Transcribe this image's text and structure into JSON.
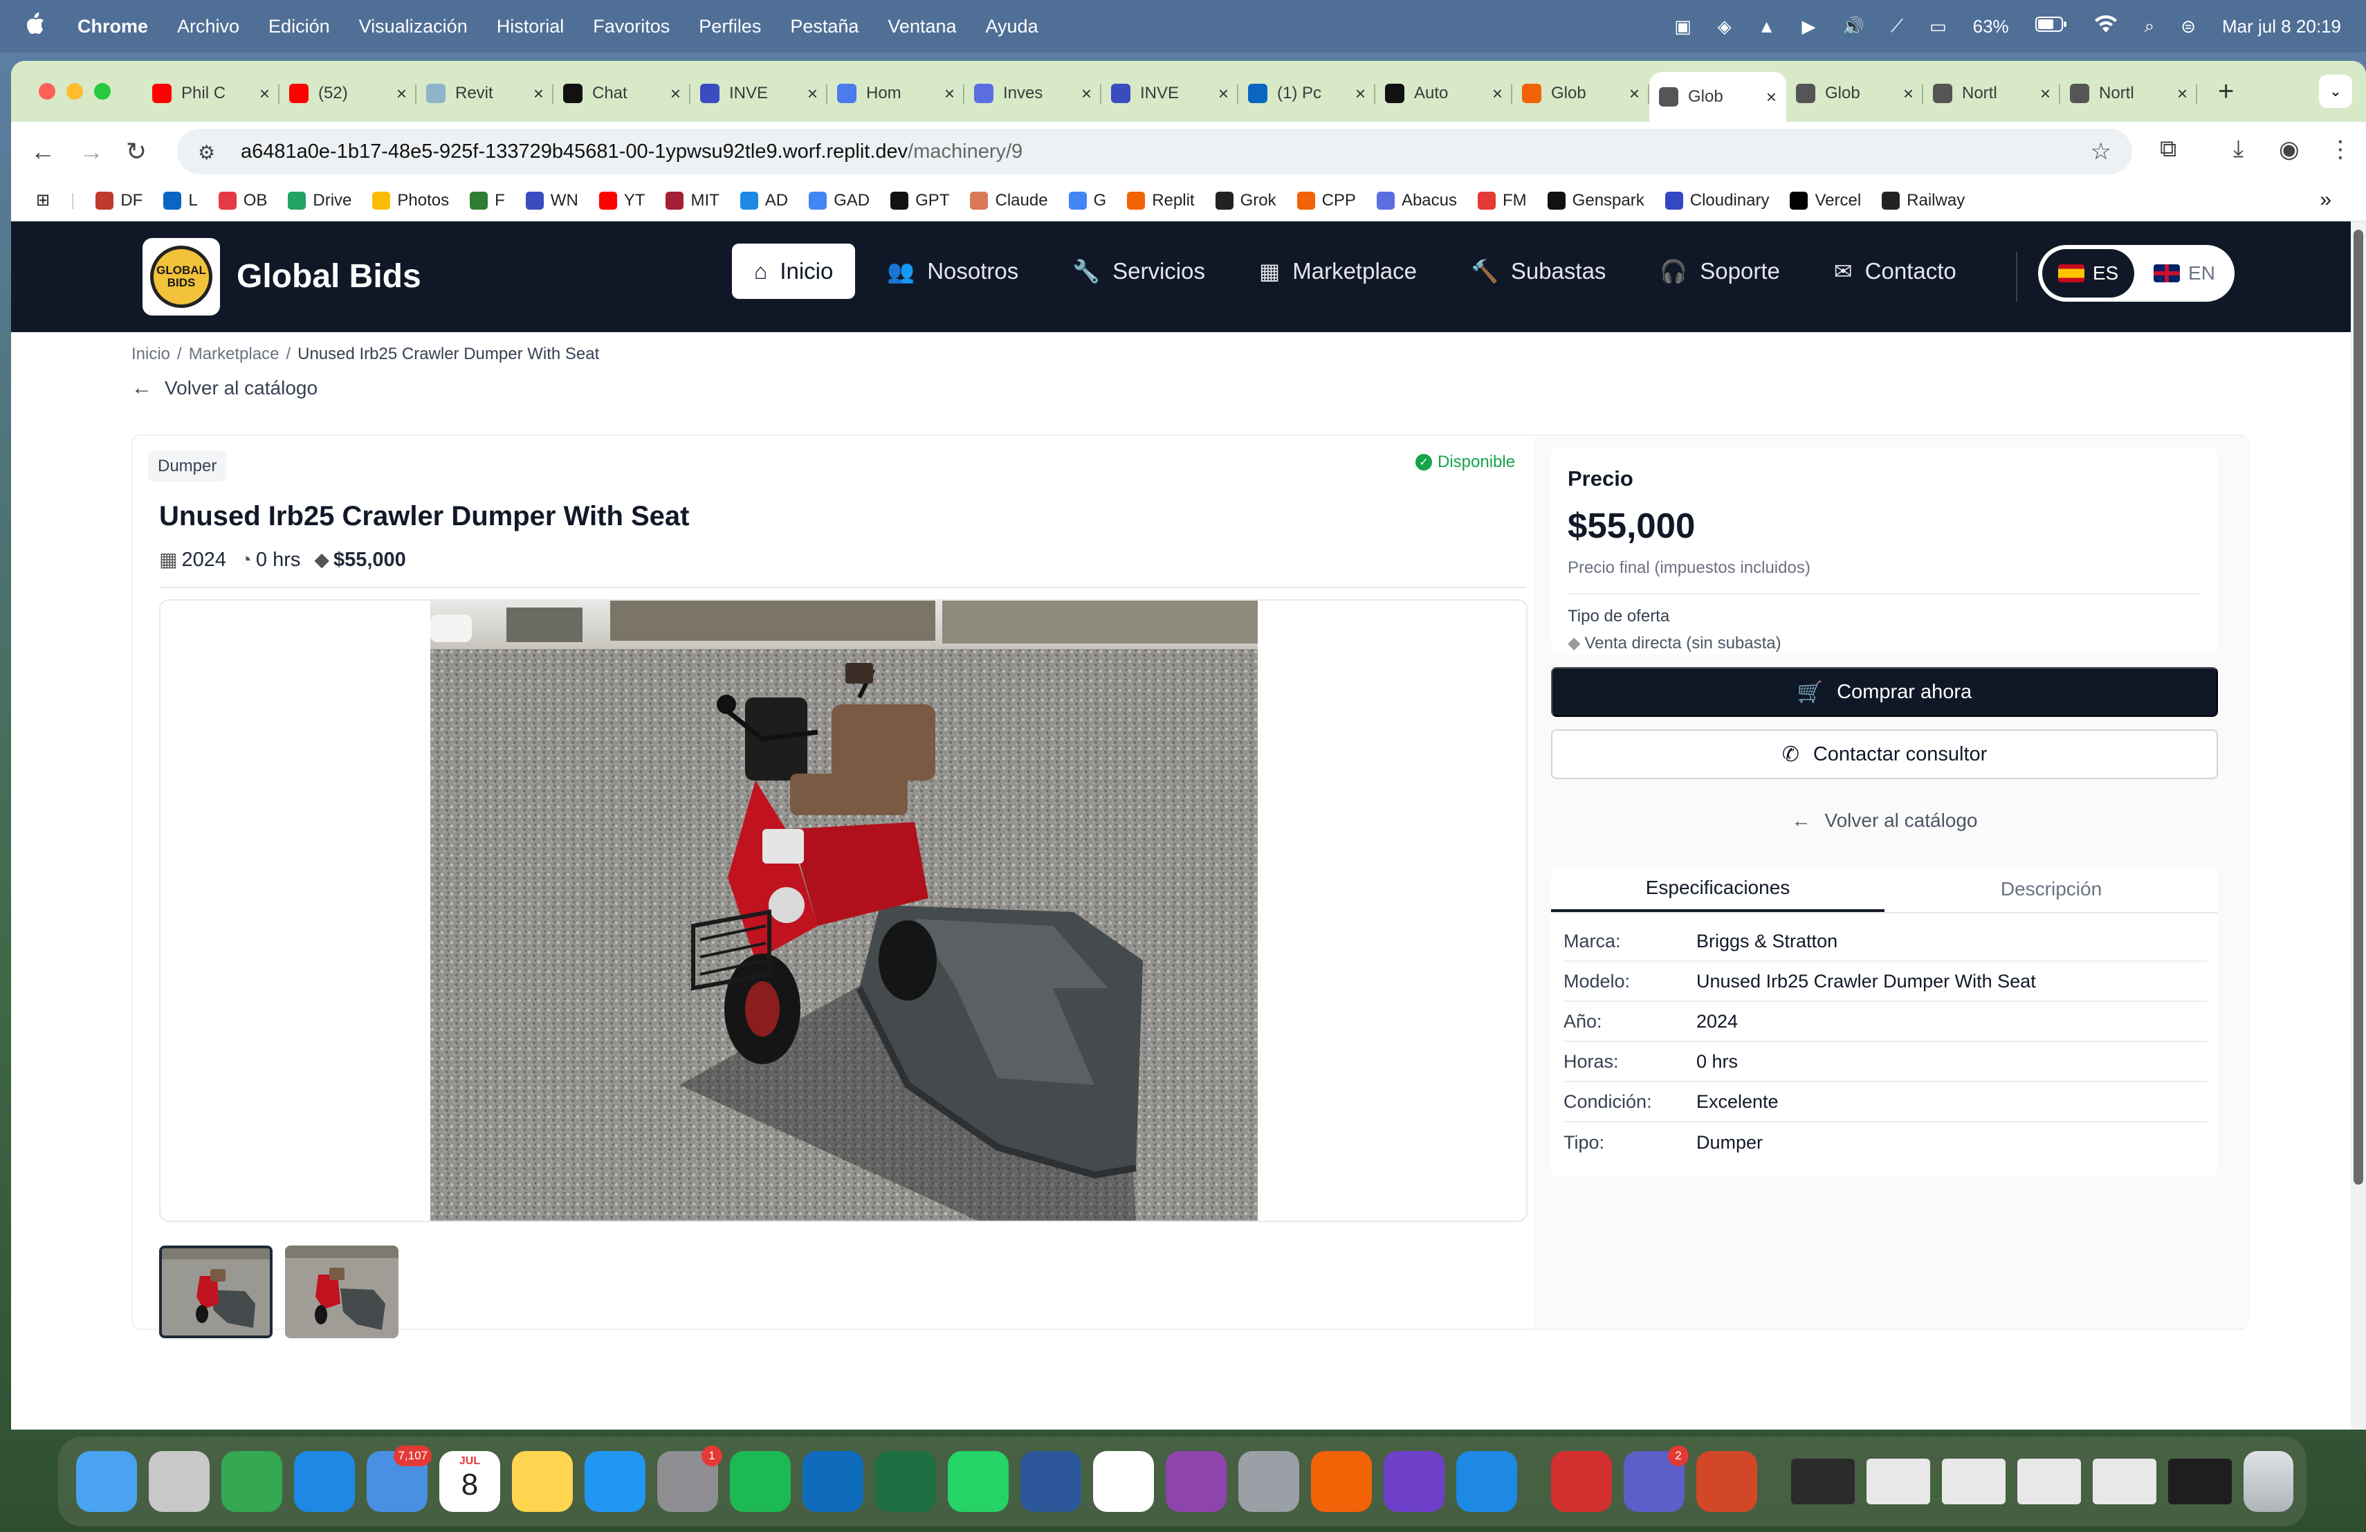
{
  "menubar": {
    "apple": "",
    "items": [
      "Chrome",
      "Archivo",
      "Edición",
      "Visualización",
      "Historial",
      "Favoritos",
      "Perfiles",
      "Pestaña",
      "Ventana",
      "Ayuda"
    ],
    "battery": "63%",
    "datetime": "Mar jul 8  20:19"
  },
  "browser": {
    "tabs": [
      {
        "title": "Phil C",
        "icon": "youtube-icon",
        "color": "#ff0000"
      },
      {
        "title": "(52) ",
        "icon": "youtube-icon",
        "color": "#ff0000"
      },
      {
        "title": "Revit",
        "icon": "revit-icon",
        "color": "#8fb3c9"
      },
      {
        "title": "Chat",
        "icon": "openai-icon",
        "color": "#111111"
      },
      {
        "title": "INVE",
        "icon": "site-icon",
        "color": "#3b4cc0"
      },
      {
        "title": "Hom",
        "icon": "site-icon",
        "color": "#4b7bec"
      },
      {
        "title": "Inves",
        "icon": "site-icon",
        "color": "#5b6ee1"
      },
      {
        "title": "INVE",
        "icon": "site-icon",
        "color": "#3b4cc0"
      },
      {
        "title": "(1) Pc",
        "icon": "linkedin-icon",
        "color": "#0a66c2"
      },
      {
        "title": "Auto",
        "icon": "openai-icon",
        "color": "#111111"
      },
      {
        "title": "Glob",
        "icon": "replit-icon",
        "color": "#f26207"
      },
      {
        "title": "Glob",
        "icon": "globe-icon",
        "color": "#555555",
        "active": true
      },
      {
        "title": "Glob",
        "icon": "globe-icon",
        "color": "#555555"
      },
      {
        "title": "Nortl",
        "icon": "globe-icon",
        "color": "#555555"
      },
      {
        "title": "Nortl",
        "icon": "globe-icon",
        "color": "#555555"
      }
    ],
    "tab_close": "×",
    "new_tab": "+",
    "url_host": "a6481a0e-1b17-48e5-925f-133729b45681-00-1ypwsu92tle9.worf.replit.dev",
    "url_path": "/machinery/9",
    "bookmarks": [
      {
        "label": "DF",
        "color": "#c0392b"
      },
      {
        "label": "L",
        "color": "#0a66c2"
      },
      {
        "label": "OB",
        "color": "#e63946"
      },
      {
        "label": "Drive",
        "color": "#1fa463"
      },
      {
        "label": "Photos",
        "color": "#fbbc04"
      },
      {
        "label": "F",
        "color": "#2e7d32"
      },
      {
        "label": "WN",
        "color": "#3b4cc0"
      },
      {
        "label": "YT",
        "color": "#ff0000"
      },
      {
        "label": "MIT",
        "color": "#a31f34"
      },
      {
        "label": "AD",
        "color": "#1e88e5"
      },
      {
        "label": "GAD",
        "color": "#4285f4"
      },
      {
        "label": "GPT",
        "color": "#111111"
      },
      {
        "label": "Claude",
        "color": "#d97757"
      },
      {
        "label": "G",
        "color": "#4285f4"
      },
      {
        "label": "Replit",
        "color": "#f26207"
      },
      {
        "label": "Grok",
        "color": "#222222"
      },
      {
        "label": "CPP",
        "color": "#f26207"
      },
      {
        "label": "Abacus",
        "color": "#5b6ee1"
      },
      {
        "label": "FM",
        "color": "#e53935"
      },
      {
        "label": "Genspark",
        "color": "#111111"
      },
      {
        "label": "Cloudinary",
        "color": "#3448c5"
      },
      {
        "label": "Vercel",
        "color": "#000000"
      },
      {
        "label": "Railway",
        "color": "#222222"
      }
    ],
    "bookmarks_more": "»"
  },
  "site": {
    "logo_text": "GLOBAL BIDS",
    "title": "Global Bids",
    "nav": [
      {
        "label": "Inicio",
        "icon": "home-icon",
        "glyph": "⌂",
        "active": true
      },
      {
        "label": "Nosotros",
        "icon": "users-icon",
        "glyph": "👥"
      },
      {
        "label": "Servicios",
        "icon": "wrench-icon",
        "glyph": "🔧"
      },
      {
        "label": "Marketplace",
        "icon": "grid-icon",
        "glyph": "▦"
      },
      {
        "label": "Subastas",
        "icon": "gavel-icon",
        "glyph": "🔨"
      },
      {
        "label": "Soporte",
        "icon": "headset-icon",
        "glyph": "🎧"
      },
      {
        "label": "Contacto",
        "icon": "envelope-icon",
        "glyph": "✉"
      }
    ],
    "lang": {
      "es": "ES",
      "en": "EN"
    }
  },
  "breadcrumb": {
    "home": "Inicio",
    "section": "Marketplace",
    "current": "Unused Irb25 Crawler Dumper With Seat",
    "separator": "/"
  },
  "back_link": "Volver al catálogo",
  "product": {
    "category": "Dumper",
    "status": "Disponible",
    "title": "Unused Irb25 Crawler Dumper With Seat",
    "year": "2024",
    "hours": "0 hrs",
    "price": "$55,000",
    "thumbnails_count": 2
  },
  "pricing": {
    "label": "Precio",
    "value": "$55,000",
    "note": "Precio final (impuestos incluidos)",
    "offer_label": "Tipo de oferta",
    "offer_value": "Venta directa (sin subasta)",
    "buy_label": "Comprar ahora",
    "contact_label": "Contactar consultor",
    "back_label": "Volver al catálogo"
  },
  "specs": {
    "tab_specs": "Especificaciones",
    "tab_desc": "Descripción",
    "rows": [
      {
        "k": "Marca:",
        "v": "Briggs & Stratton"
      },
      {
        "k": "Modelo:",
        "v": "Unused Irb25 Crawler Dumper With Seat"
      },
      {
        "k": "Año:",
        "v": "2024"
      },
      {
        "k": "Horas:",
        "v": "0 hrs"
      },
      {
        "k": "Condición:",
        "v": "Excelente"
      },
      {
        "k": "Tipo:",
        "v": "Dumper"
      }
    ]
  },
  "dock": {
    "apps": [
      {
        "name": "finder-icon",
        "color": "#4aa3f0"
      },
      {
        "name": "launchpad-icon",
        "color": "#c8c8c8"
      },
      {
        "name": "chrome-icon",
        "color": "#34a853"
      },
      {
        "name": "safari-icon",
        "color": "#1e88e5"
      },
      {
        "name": "mail-icon",
        "color": "#4a90e2",
        "badge": "7,107"
      },
      {
        "name": "calendar-icon",
        "color": "#ffffff",
        "badge_text_top": "JUL",
        "badge_text_day": "8"
      },
      {
        "name": "notes-icon",
        "color": "#ffd54f"
      },
      {
        "name": "keynote-icon",
        "color": "#2196f3"
      },
      {
        "name": "settings-icon",
        "color": "#8e8e93",
        "badge": "1"
      },
      {
        "name": "spotify-icon",
        "color": "#1db954"
      },
      {
        "name": "outlook-icon",
        "color": "#0f6cbd"
      },
      {
        "name": "excel-icon",
        "color": "#1d6f42"
      },
      {
        "name": "whatsapp-icon",
        "color": "#25d366"
      },
      {
        "name": "word-icon",
        "color": "#2b579a"
      },
      {
        "name": "calendar31-icon",
        "color": "#ffffff"
      },
      {
        "name": "circle-app-icon",
        "color": "#8e44ad"
      },
      {
        "name": "iphone-mirroring-icon",
        "color": "#9aa0a6"
      },
      {
        "name": "replit-icon",
        "color": "#f26207"
      },
      {
        "name": "github-icon",
        "color": "#6e40c9"
      },
      {
        "name": "vscode-icon",
        "color": "#1e88e5"
      },
      {
        "name": "acrobat-icon",
        "color": "#d32f2f"
      },
      {
        "name": "teams-icon",
        "color": "#5b5fc7",
        "badge": "2"
      },
      {
        "name": "powerpoint-icon",
        "color": "#d24726"
      }
    ],
    "trash": "trash-icon"
  }
}
